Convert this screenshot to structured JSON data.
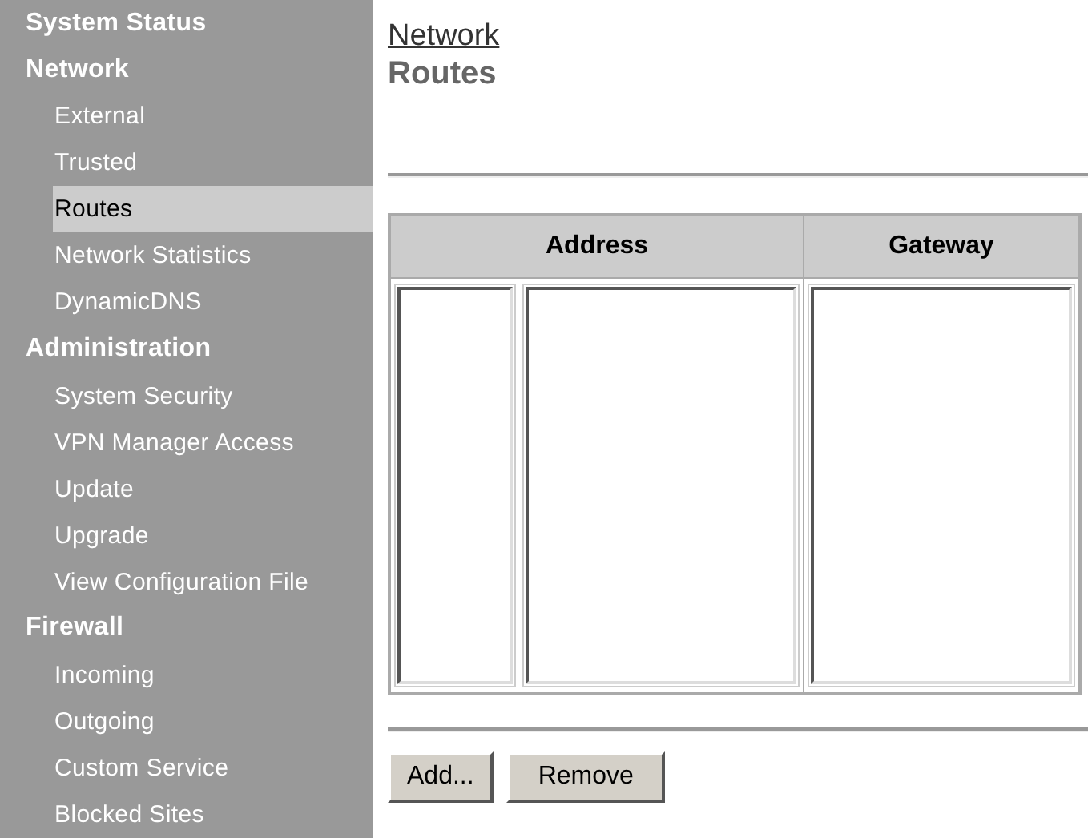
{
  "sidebar": {
    "items": [
      {
        "kind": "section",
        "label": "System Status",
        "selected": false
      },
      {
        "kind": "section",
        "label": "Network",
        "selected": false
      },
      {
        "kind": "link",
        "label": "External",
        "selected": false
      },
      {
        "kind": "link",
        "label": "Trusted",
        "selected": false
      },
      {
        "kind": "link",
        "label": "Routes",
        "selected": true
      },
      {
        "kind": "link",
        "label": "Network Statistics",
        "selected": false
      },
      {
        "kind": "link",
        "label": "DynamicDNS",
        "selected": false
      },
      {
        "kind": "section",
        "label": "Administration",
        "selected": false
      },
      {
        "kind": "link",
        "label": "System Security",
        "selected": false
      },
      {
        "kind": "link",
        "label": "VPN Manager Access",
        "selected": false
      },
      {
        "kind": "link",
        "label": "Update",
        "selected": false
      },
      {
        "kind": "link",
        "label": "Upgrade",
        "selected": false
      },
      {
        "kind": "link",
        "label": "View Configuration File",
        "selected": false
      },
      {
        "kind": "section",
        "label": "Firewall",
        "selected": false
      },
      {
        "kind": "link",
        "label": "Incoming",
        "selected": false
      },
      {
        "kind": "link",
        "label": "Outgoing",
        "selected": false
      },
      {
        "kind": "link",
        "label": "Custom Service",
        "selected": false
      },
      {
        "kind": "link",
        "label": "Blocked Sites",
        "selected": false
      }
    ]
  },
  "breadcrumb": "Network",
  "page_title": "Routes",
  "table": {
    "columns": [
      "Address",
      "Gateway"
    ]
  },
  "buttons": [
    "Add...",
    "Remove"
  ]
}
